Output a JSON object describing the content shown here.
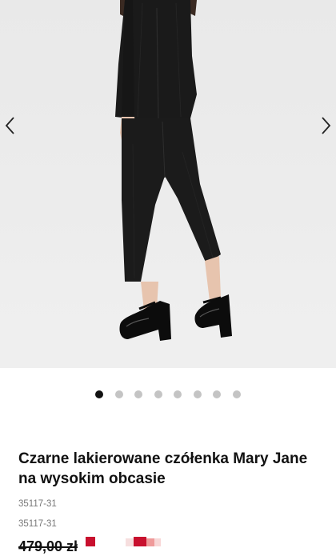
{
  "gallery": {
    "image_alt": "Czarne lakierowane czółenka Mary Jane na wysokim obcasie",
    "prev_icon": "chevron-left-icon",
    "next_icon": "chevron-right-icon",
    "slide_count": 8,
    "active_index": 0
  },
  "product": {
    "title": "Czarne lakierowane czółenka Mary Jane na wysokim obcasie",
    "sku_1": "35117-31",
    "sku_2": "35117-31",
    "old_price": "479,00 zł"
  },
  "colors": {
    "accent_red": "#c8102e",
    "text": "#111111",
    "muted": "#777777",
    "dot_inactive": "#c4c4c4"
  }
}
